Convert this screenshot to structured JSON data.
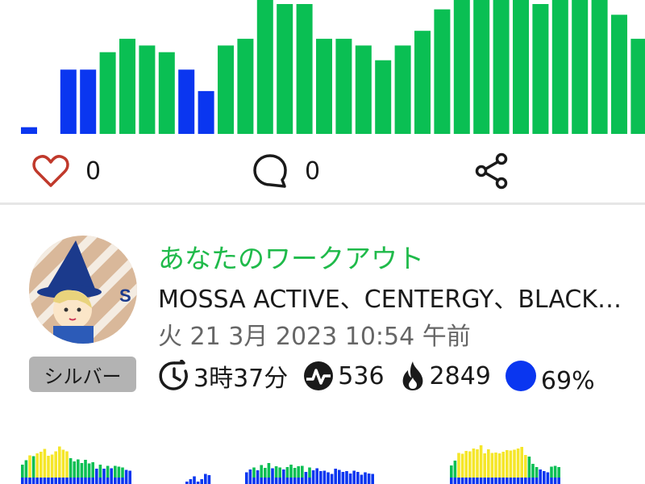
{
  "chart_data": [
    {
      "type": "bar",
      "values": [
        5,
        0,
        48,
        48,
        61,
        71,
        66,
        61,
        48,
        32,
        66,
        71,
        100,
        97,
        97,
        71,
        71,
        66,
        55,
        66,
        77,
        93,
        100,
        100,
        100,
        100,
        97,
        100,
        100,
        100,
        89,
        71
      ],
      "colors": [
        "blue",
        "none",
        "blue",
        "blue",
        "green",
        "green",
        "green",
        "green",
        "blue",
        "blue",
        "green",
        "green",
        "green",
        "green",
        "green",
        "green",
        "green",
        "green",
        "green",
        "green",
        "green",
        "green",
        "green",
        "green",
        "green",
        "green",
        "green",
        "green",
        "green",
        "green",
        "green",
        "green"
      ],
      "palette": {
        "blue": "#0a36f0",
        "green": "#0abf53"
      }
    },
    {
      "type": "bar",
      "segments": [
        {
          "values": [
            48,
            59,
            71,
            69,
            76,
            80,
            87,
            70,
            73,
            81,
            93,
            85,
            81,
            64,
            56,
            61,
            52,
            60,
            51,
            54,
            38,
            48,
            38,
            45,
            39,
            45,
            43,
            41,
            35,
            33
          ]
        },
        {
          "values": [
            6,
            12,
            19,
            6,
            12,
            25,
            22
          ]
        },
        {
          "values": [
            29,
            36,
            41,
            34,
            47,
            40,
            52,
            39,
            44,
            41,
            36,
            42,
            48,
            40,
            44,
            45,
            30,
            41,
            34,
            39,
            32,
            33,
            29,
            25,
            38,
            35,
            30,
            32,
            26,
            33,
            30,
            23,
            29,
            26,
            25
          ]
        },
        {
          "values": [
            46,
            58,
            77,
            75,
            82,
            81,
            88,
            86,
            96,
            76,
            86,
            77,
            78,
            76,
            80,
            84,
            83,
            85,
            88,
            92,
            72,
            68,
            50,
            42,
            36,
            32,
            29,
            43,
            45,
            42
          ]
        }
      ],
      "palette": {
        "blue": "#0a36f0",
        "green": "#0abf53",
        "yellow": "#f5e629"
      }
    }
  ],
  "post": {
    "likes": "0",
    "comments": "0"
  },
  "workout": {
    "title": "あなたのワークアウト",
    "programs": "MOSSA ACTIVE、CENTERGY、BLACKROLL、POWER",
    "date": "火 21 3月 2023 10:54 午前",
    "badge": "シルバー",
    "duration": "3時37分",
    "effort": "536",
    "calories": "2849",
    "percent": "69%",
    "percent_color": "#0a36f0",
    "title_color": "#1fba4a"
  },
  "icons": {
    "like": "heart-outline-icon",
    "comment": "comment-bubble-icon",
    "share": "share-icon",
    "duration": "clock-refresh-icon",
    "effort": "heartbeat-icon",
    "calories": "flame-icon",
    "zone": "blue-dot-icon"
  }
}
